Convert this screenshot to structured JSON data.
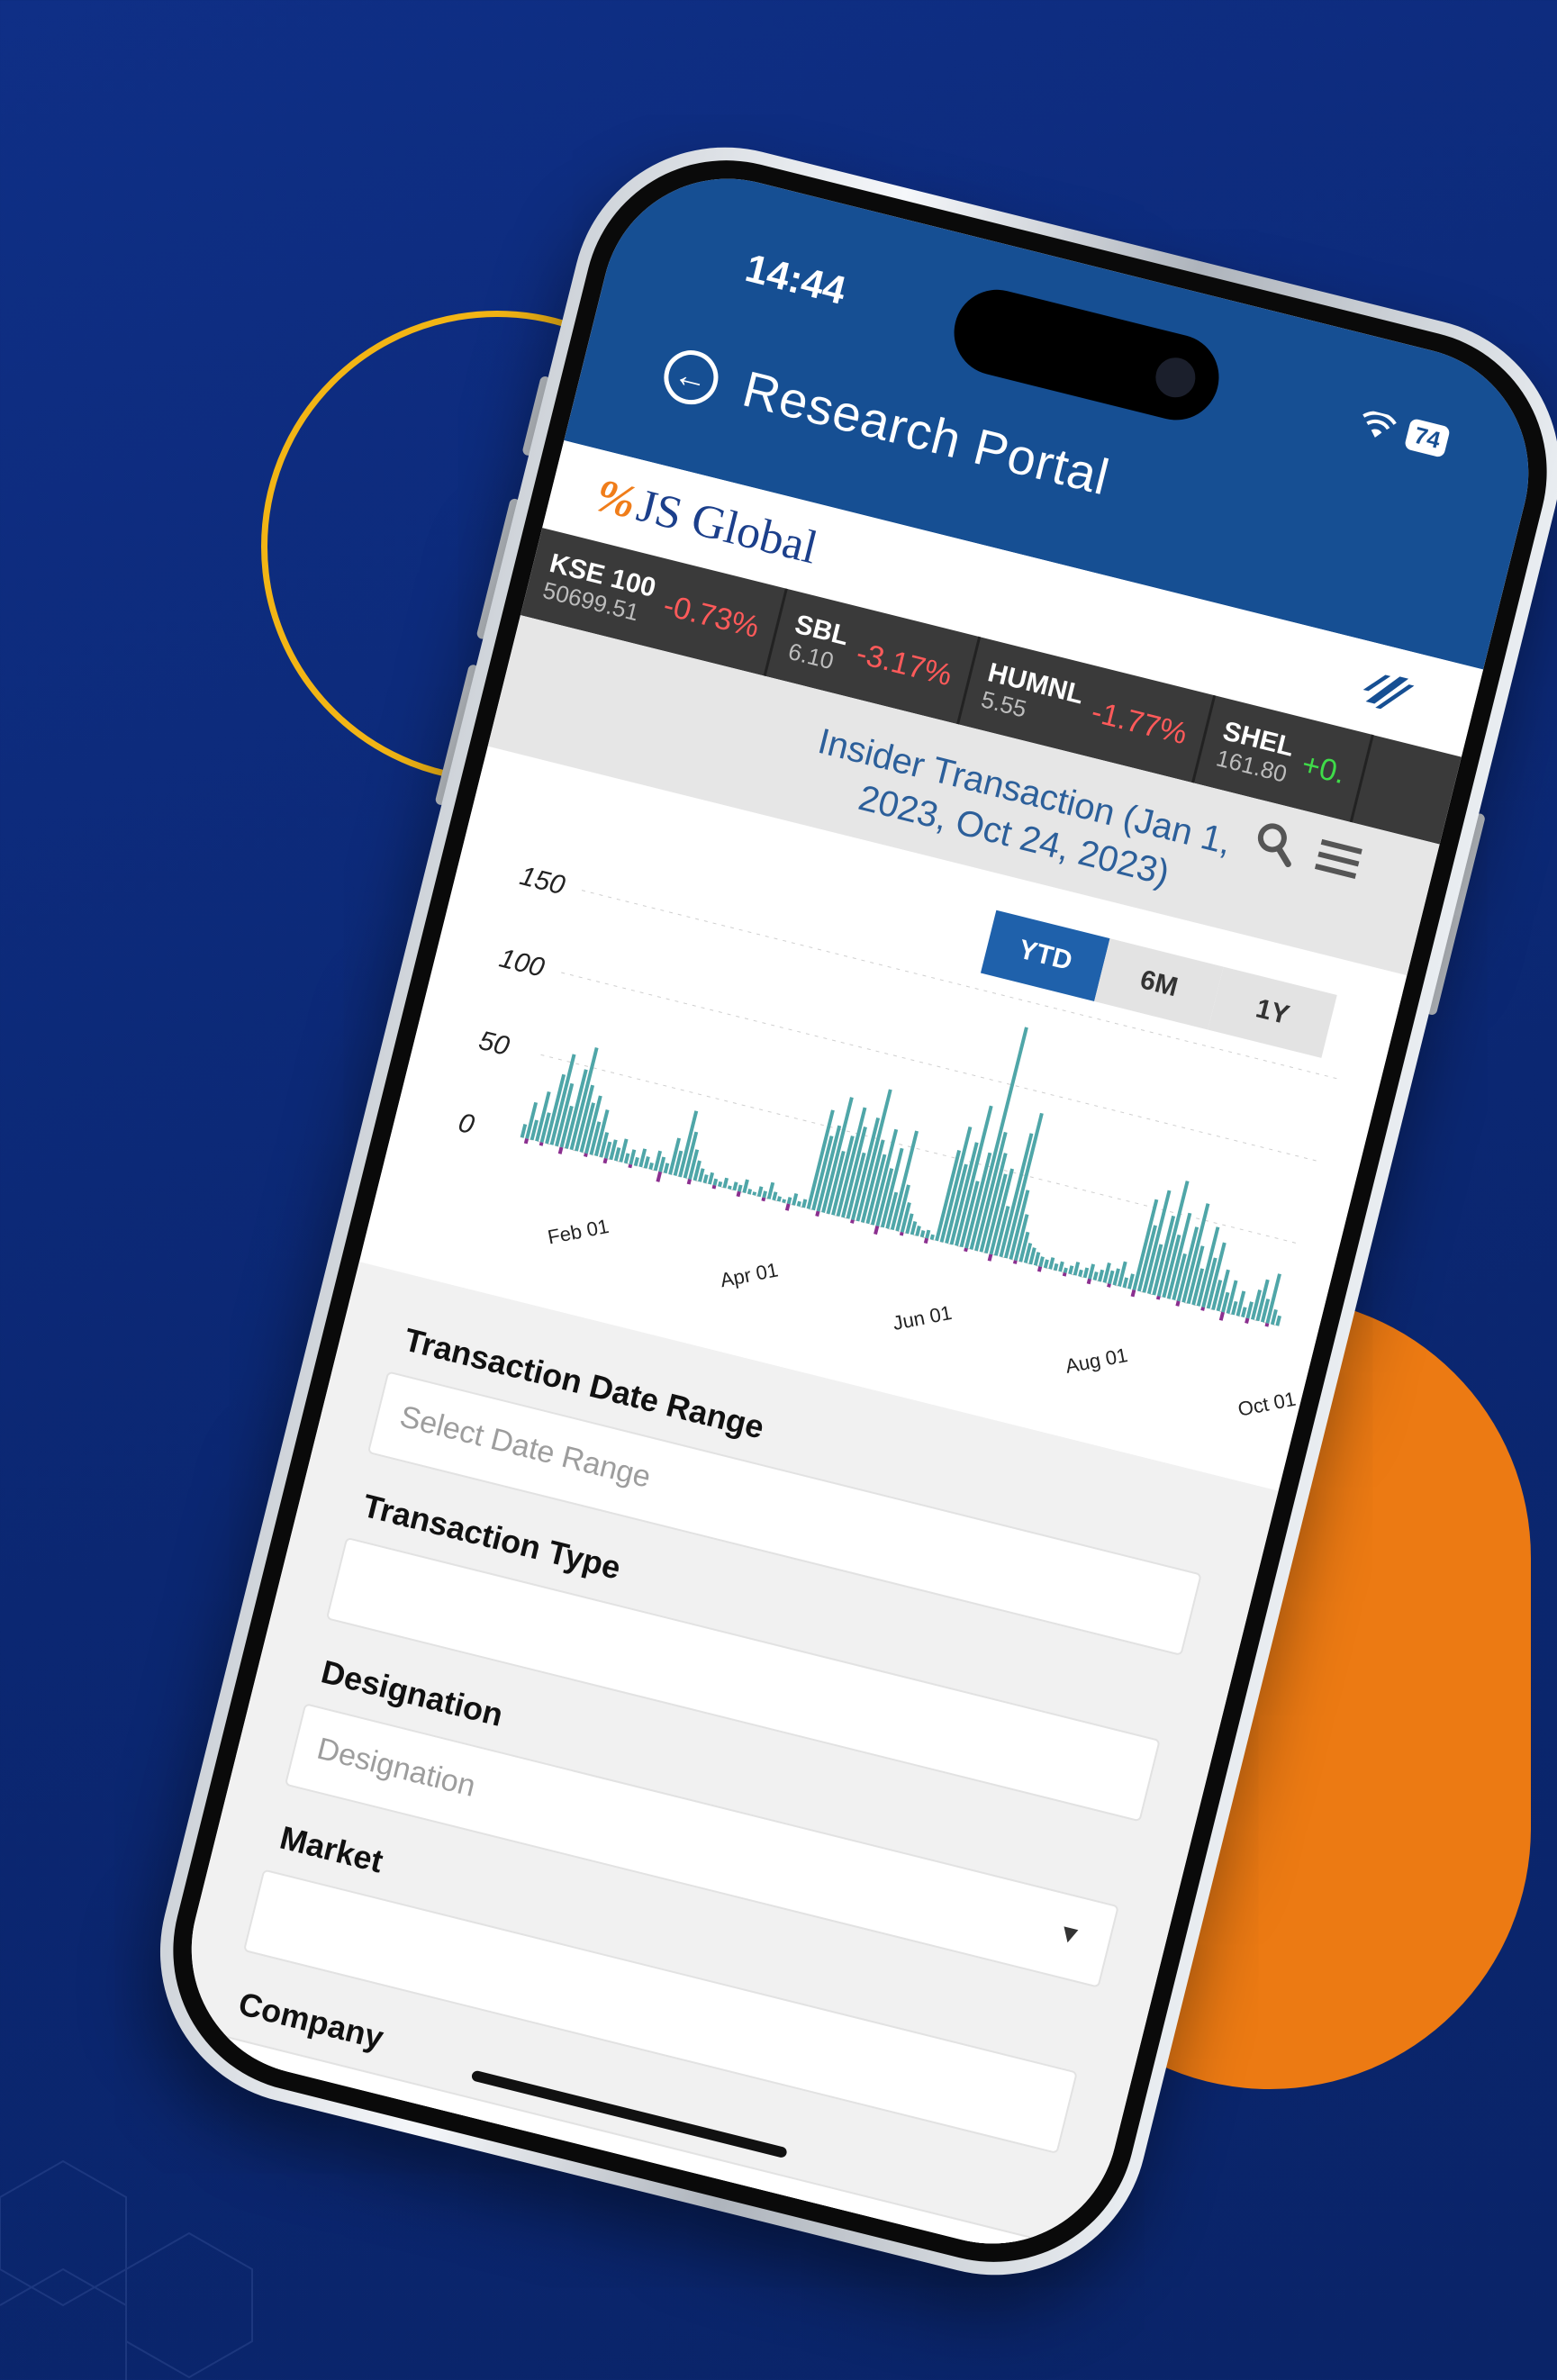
{
  "status_bar": {
    "time": "14:44",
    "battery": "74"
  },
  "header": {
    "title": "Research Portal"
  },
  "brand": {
    "logo_text": "JS Global"
  },
  "ticker": [
    {
      "symbol": "KSE 100",
      "price": "50699.51",
      "change": "-0.73%",
      "direction": "down"
    },
    {
      "symbol": "SBL",
      "price": "6.10",
      "change": "-3.17%",
      "direction": "down"
    },
    {
      "symbol": "HUMNL",
      "price": "5.55",
      "change": "-1.77%",
      "direction": "down"
    },
    {
      "symbol": "SHEL",
      "price": "161.80",
      "change": "+0.",
      "direction": "up"
    }
  ],
  "nav": {
    "search_icon": "search-icon",
    "menu_icon": "menu-icon"
  },
  "chart": {
    "title_line1": "Insider Transaction (Jan 1,",
    "title_line2": "2023, Oct 24, 2023)",
    "range_tabs": [
      "YTD",
      "6M",
      "1Y"
    ],
    "active_tab": "YTD"
  },
  "chart_data": {
    "type": "bar",
    "title": "Insider Transaction (Jan 1, 2023, Oct 24, 2023)",
    "ylim": [
      -20,
      150
    ],
    "yticks": [
      0,
      50,
      100,
      150
    ],
    "xticks": [
      "Feb 01",
      "Apr 01",
      "Jun 01",
      "Aug 01",
      "Oct 01"
    ],
    "grid": true,
    "colors": {
      "positive": "#4fa6a8",
      "negative": "#8b2f8f"
    },
    "series": [
      {
        "values": [
          8,
          22,
          12,
          30,
          18,
          42,
          55,
          38,
          25,
          48,
          62,
          40,
          30,
          35,
          20,
          28,
          15,
          10,
          12,
          8,
          14,
          6,
          9,
          5,
          11,
          7,
          4,
          12,
          9,
          6,
          22,
          15,
          40,
          28,
          18,
          12,
          8,
          5,
          7,
          4,
          3,
          6,
          2,
          5,
          4,
          8,
          3,
          2,
          6,
          4,
          10,
          5,
          3,
          2,
          4,
          7,
          3,
          5,
          60,
          45,
          52,
          70,
          38,
          48,
          66,
          55,
          40,
          62,
          80,
          50,
          42,
          58,
          35,
          48,
          22,
          60,
          28,
          18,
          12,
          8,
          6,
          4,
          5,
          3,
          55,
          70,
          48,
          62,
          85,
          40,
          58,
          135,
          72,
          60,
          48,
          52,
          30,
          75,
          88,
          42,
          28,
          18,
          12,
          10,
          8,
          6,
          5,
          7,
          4,
          6,
          3,
          5,
          8,
          4,
          6,
          9,
          5,
          7,
          12,
          8,
          10,
          15,
          6,
          9,
          55,
          40,
          62,
          30,
          48,
          70,
          38,
          52,
          28,
          45,
          60,
          35,
          22,
          48,
          30,
          40,
          18,
          25,
          12,
          20,
          8,
          15,
          6,
          10,
          18,
          25,
          14,
          30,
          9,
          6
        ],
        "negatives": [
          0,
          -3,
          0,
          0,
          -2,
          0,
          0,
          0,
          -4,
          0,
          0,
          0,
          0,
          -2,
          0,
          0,
          0,
          -3,
          0,
          0,
          0,
          0,
          -2,
          0,
          0,
          0,
          0,
          0,
          -6,
          0,
          0,
          0,
          0,
          0,
          -3,
          0,
          0,
          0,
          0,
          -2,
          0,
          0,
          0,
          0,
          -3,
          0,
          0,
          0,
          0,
          -2,
          0,
          0,
          0,
          0,
          -4,
          0,
          0,
          0,
          0,
          0,
          -3,
          0,
          0,
          0,
          0,
          0,
          0,
          -2,
          0,
          0,
          0,
          0,
          -5,
          0,
          0,
          0,
          0,
          -2,
          0,
          0,
          0,
          0,
          -3,
          0,
          0,
          0,
          0,
          0,
          0,
          0,
          -2,
          0,
          0,
          0,
          0,
          -4,
          0,
          0,
          0,
          0,
          -2,
          0,
          0,
          0,
          0,
          -3,
          0,
          0,
          0,
          0,
          -2,
          0,
          0,
          0,
          0,
          -3,
          0,
          0,
          0,
          -2,
          0,
          0,
          0,
          0,
          -4,
          0,
          0,
          0,
          0,
          -2,
          0,
          0,
          0,
          -3,
          0,
          0,
          0,
          0,
          -2,
          0,
          0,
          0,
          -5,
          0,
          0,
          0,
          0,
          -3,
          0,
          0,
          0,
          -2,
          0,
          0,
          0,
          -4,
          0
        ]
      }
    ]
  },
  "form": {
    "date_range_label": "Transaction Date Range",
    "date_range_placeholder": "Select Date Range",
    "type_label": "Transaction Type",
    "designation_label": "Designation",
    "designation_placeholder": "Designation",
    "market_label": "Market",
    "company_label": "Company"
  }
}
